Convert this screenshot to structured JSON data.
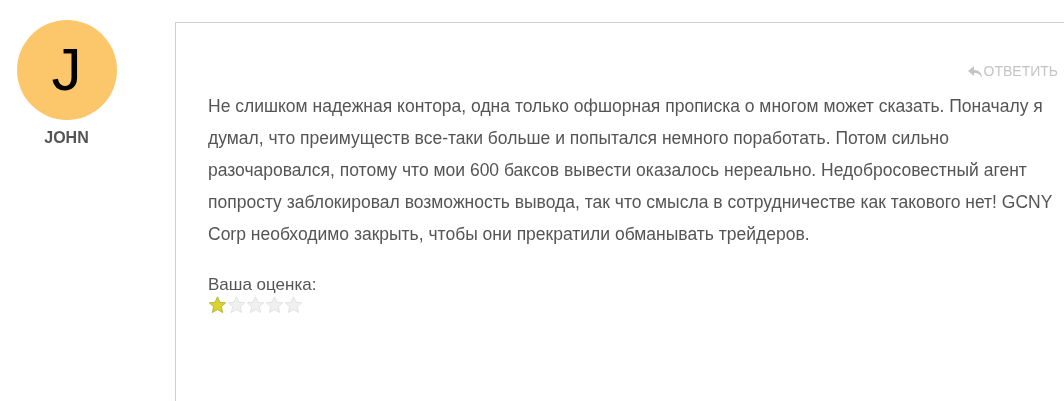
{
  "author": {
    "initial": "J",
    "name": "JOHN"
  },
  "reply": {
    "label": "ОТВЕТИТЬ"
  },
  "comment": {
    "text": "Не слишком надежная контора, одна только офшорная прописка о многом может сказать. Поначалу я думал, что преимуществ все-таки больше и попытался немного поработать. Потом сильно разочаровался, потому что мои 600 баксов вывести оказалось нереально. Недобросовестный агент попросту заблокировал возможность вывода, так что смысла в сотрудничестве как такового нет! GCNY Corp необходимо закрыть, чтобы они прекратили обманывать трейдеров."
  },
  "rating": {
    "label": "Ваша оценка:",
    "stars": 1
  }
}
